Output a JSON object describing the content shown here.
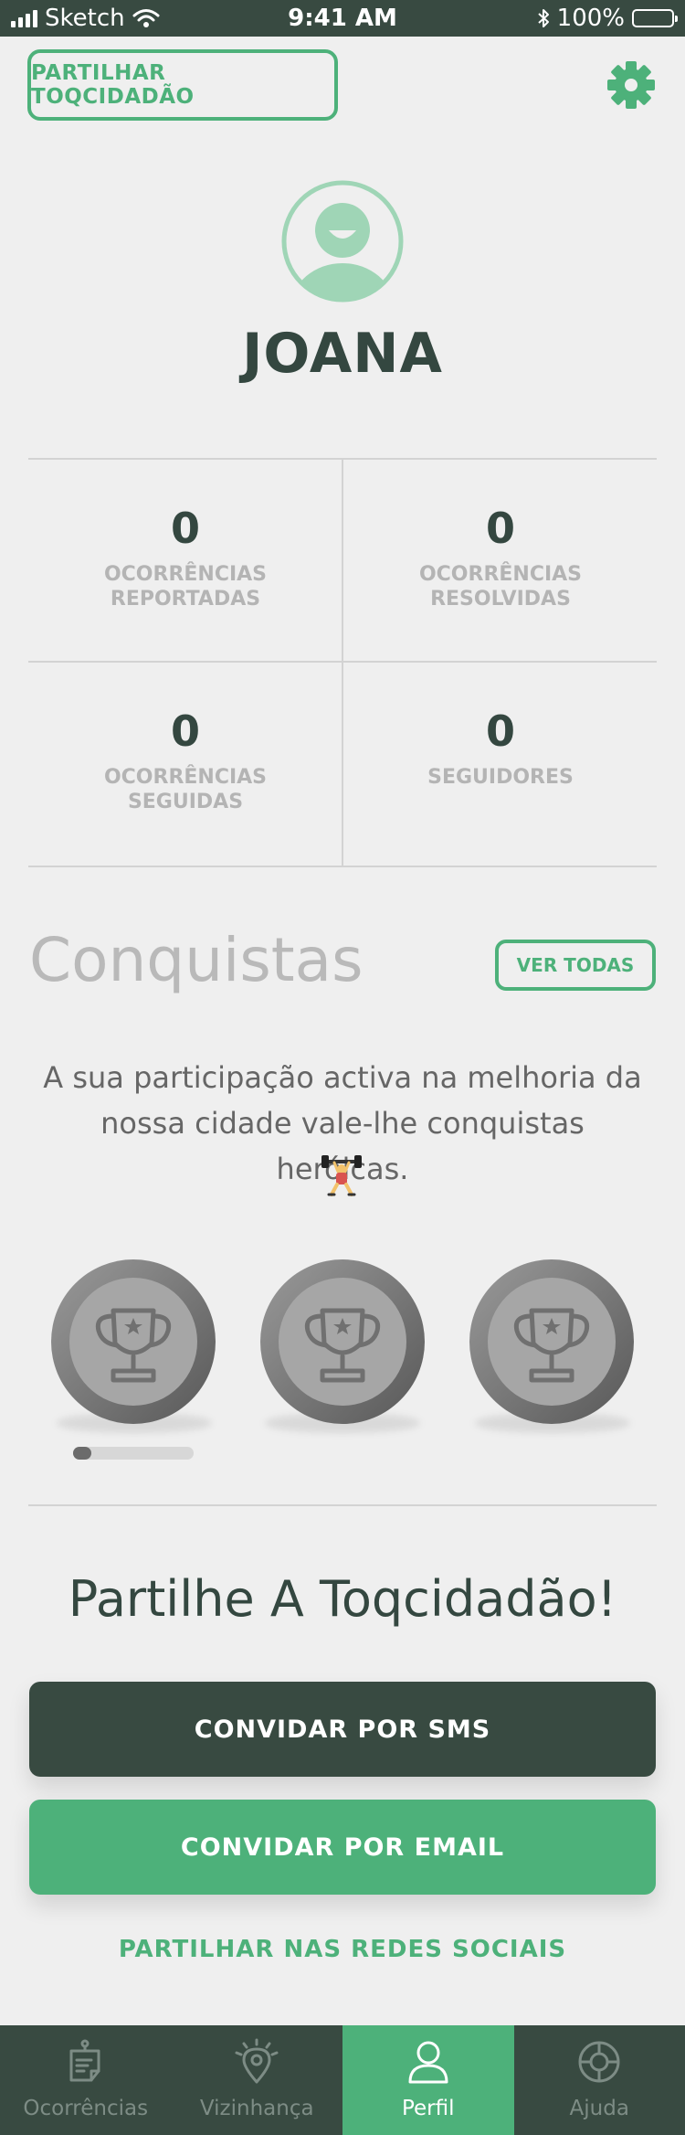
{
  "status_bar": {
    "carrier": "Sketch",
    "time": "9:41 AM",
    "battery": "100%"
  },
  "header": {
    "share_button": "PARTILHAR TOQCIDADÃO",
    "settings_icon": "gear-icon"
  },
  "profile": {
    "name": "JOANA",
    "avatar_icon": "user-avatar-icon"
  },
  "stats": [
    {
      "value": "0",
      "label_line1": "OCORRÊNCIAS",
      "label_line2": "REPORTADAS"
    },
    {
      "value": "0",
      "label_line1": "OCORRÊNCIAS",
      "label_line2": "RESOLVIDAS"
    },
    {
      "value": "0",
      "label_line1": "OCORRÊNCIAS",
      "label_line2": "SEGUIDAS"
    },
    {
      "value": "0",
      "label_line1": "SEGUIDORES",
      "label_line2": ""
    }
  ],
  "achievements": {
    "title": "Conquistas",
    "see_all": "VER TODAS",
    "description_line1": "A sua participação activa na melhoria da",
    "description_line2": "nossa cidade vale-lhe conquistas heróicas.",
    "emoji_icon": "weightlifter-icon",
    "trophies": [
      "trophy-icon",
      "trophy-icon",
      "trophy-icon"
    ],
    "progress_fraction": 0.15
  },
  "share": {
    "title": "Partilhe A Toqcidadão!",
    "sms_button": "CONVIDAR POR SMS",
    "email_button": "CONVIDAR POR EMAIL",
    "social_link": "PARTILHAR NAS REDES SOCIAIS"
  },
  "tabbar": {
    "items": [
      {
        "label": "Ocorrências",
        "icon": "report-icon",
        "active": false
      },
      {
        "label": "Vizinhança",
        "icon": "location-pin-icon",
        "active": false
      },
      {
        "label": "Perfil",
        "icon": "user-icon",
        "active": true
      },
      {
        "label": "Ajuda",
        "icon": "lifebuoy-icon",
        "active": false
      }
    ]
  },
  "colors": {
    "brand_green": "#4db17a",
    "dark_green": "#384a41",
    "background": "#efefef"
  }
}
